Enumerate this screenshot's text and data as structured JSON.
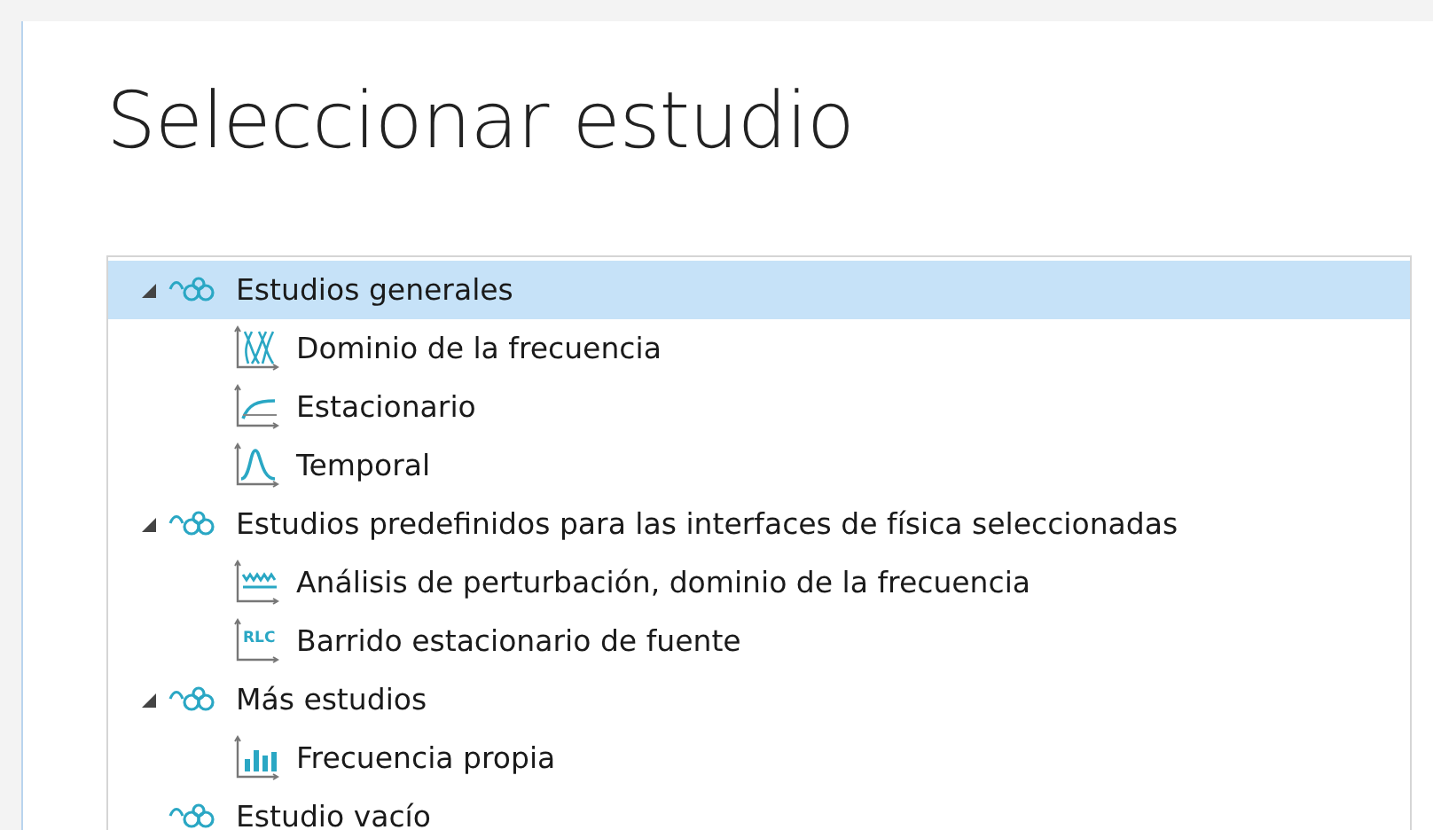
{
  "title": "Seleccionar estudio",
  "tree": [
    {
      "label": "Estudios generales",
      "kind": "group",
      "expanded": true,
      "selected": true,
      "children": [
        {
          "label": "Dominio de la frecuencia",
          "kind": "frequency",
          "selected": false
        },
        {
          "label": "Estacionario",
          "kind": "stationary",
          "selected": false
        },
        {
          "label": "Temporal",
          "kind": "temporal",
          "selected": false
        }
      ]
    },
    {
      "label": "Estudios predefinidos para las interfaces de física seleccionadas",
      "kind": "group",
      "expanded": true,
      "selected": false,
      "children": [
        {
          "label": "Análisis de perturbación, dominio de la frecuencia",
          "kind": "perturbation",
          "selected": false
        },
        {
          "label": "Barrido estacionario de fuente",
          "kind": "sweep",
          "icon_text": "RLC",
          "selected": false
        }
      ]
    },
    {
      "label": "Más estudios",
      "kind": "group",
      "expanded": true,
      "selected": false,
      "children": [
        {
          "label": "Frecuencia propia",
          "kind": "eigen",
          "selected": false
        }
      ]
    },
    {
      "label": "Estudio vacío",
      "kind": "group",
      "selected": false
    }
  ]
}
